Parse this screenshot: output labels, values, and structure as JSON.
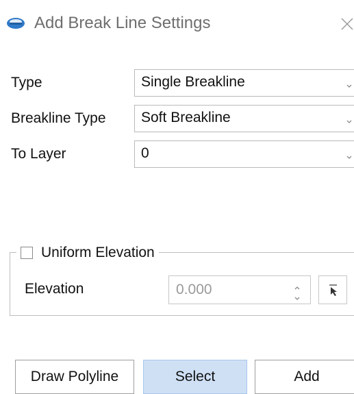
{
  "window": {
    "title": "Add Break Line Settings",
    "app_icon": "app-logo-icon",
    "close_icon": "close-icon"
  },
  "form": {
    "type_label": "Type",
    "type_value": "Single Breakline",
    "breakline_type_label": "Breakline Type",
    "breakline_type_value": "Soft Breakline",
    "to_layer_label": "To Layer",
    "to_layer_value": "0"
  },
  "elevation_group": {
    "checkbox_label": "Uniform Elevation",
    "checked": false,
    "elevation_label": "Elevation",
    "elevation_value": "0.000",
    "pick_icon": "pick-cursor-icon"
  },
  "buttons": {
    "draw_polyline": "Draw Polyline",
    "select": "Select",
    "add": "Add"
  },
  "colors": {
    "select_button_bg": "#cfe0f5",
    "title_text": "#6e6e6e",
    "disabled_text": "#9a9a9a"
  }
}
